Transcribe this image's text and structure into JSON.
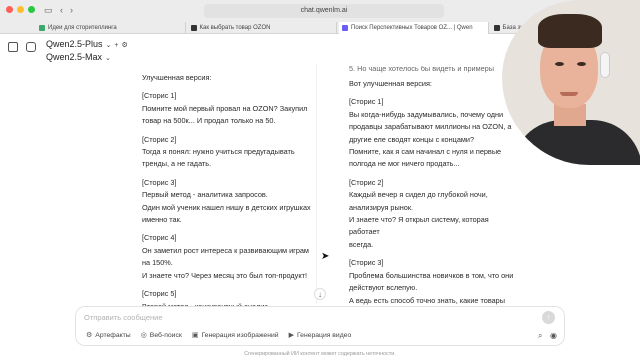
{
  "browser": {
    "url": "chat.qwenlm.ai",
    "tabs": [
      {
        "label": "Идеи для сторителлинга"
      },
      {
        "label": "Как выбрать товар OZON"
      },
      {
        "label": "Поиск Перспективных Товаров OZ... | Qwen"
      },
      {
        "label": "База знаний о сор..."
      }
    ]
  },
  "app": {
    "models": [
      "Qwen2.5-Plus",
      "Qwen2.5-Max"
    ]
  },
  "left_column": {
    "heading": "Улучшенная версия:",
    "lines": [
      "[Сторис 1]",
      "Помните мой первый провал на OZON? Закупил",
      "товар на 500к... И продал только на 50.",
      "",
      "[Сторис 2]",
      "Тогда я понял: нужно учиться предугадывать",
      "тренды, а не гадать.",
      "",
      "[Сторис 3]",
      "Первый метод - аналитика запросов.",
      "Один мой ученик нашел нишу в детских игрушках",
      "именно так.",
      "",
      "[Сторис 4]",
      "Он заметил рост интереса к развивающим играм",
      "на 150%.",
      "И знаете что? Через месяц это был топ-продукт!",
      "",
      "[Сторис 5]",
      "Второй метод - конкурентный анализ.",
      "Здесь главное не просто смотреть на лидеров..."
    ]
  },
  "right_column": {
    "top_cut": "5. Но чаще хотелось бы видеть и примеры",
    "heading": "Вот улучшенная версия:",
    "lines": [
      "[Сторис 1]",
      "Вы когда-нибудь задумывались, почему одни",
      "продавцы зарабатывают миллионы на OZON, а",
      "другие еле сводят концы с концами?",
      "Помните, как я сам начинал с нуля и первые",
      "полгода не мог ничего продать...",
      "",
      "[Сторис 2]",
      "Каждый вечер я сидел до глубокой ночи,",
      "анализируя рынок.",
      "И знаете что? Я открыл систему, которая работает",
      "всегда.",
      "",
      "[Сторис 3]",
      "Проблема большинства новичков в том, что они",
      "действуют вслепую.",
      "А ведь есть способ точно знать, какие товары",
      "будут продаваться.",
      "",
      "[Сторис 4]"
    ]
  },
  "composer": {
    "placeholder": "Отправить сообщение",
    "tools": [
      {
        "label": "Артефакты",
        "icon": "artifacts-icon"
      },
      {
        "label": "Веб-поиск",
        "icon": "globe-icon"
      },
      {
        "label": "Генерация изображений",
        "icon": "image-icon"
      },
      {
        "label": "Генерация видео",
        "icon": "video-icon"
      }
    ]
  },
  "footer": {
    "disclaimer": "Сгенерированный ИИ контент может содержать неточности."
  }
}
